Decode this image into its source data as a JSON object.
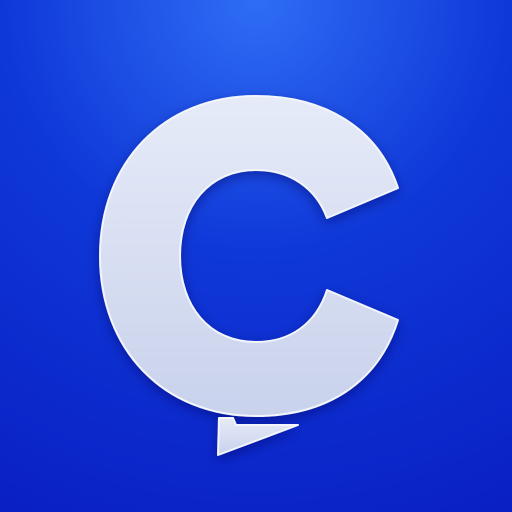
{
  "app_icon": {
    "glyph": "ç",
    "name": "cedilla-c-logo",
    "colors": {
      "background_center": "#2f6df5",
      "background_mid": "#0f38d8",
      "background_edge": "#0a20c4",
      "glyph_fill": "#c9d2ec",
      "glyph_highlight": "#e6ebf8",
      "glyph_stroke": "#f3f5fc"
    }
  }
}
